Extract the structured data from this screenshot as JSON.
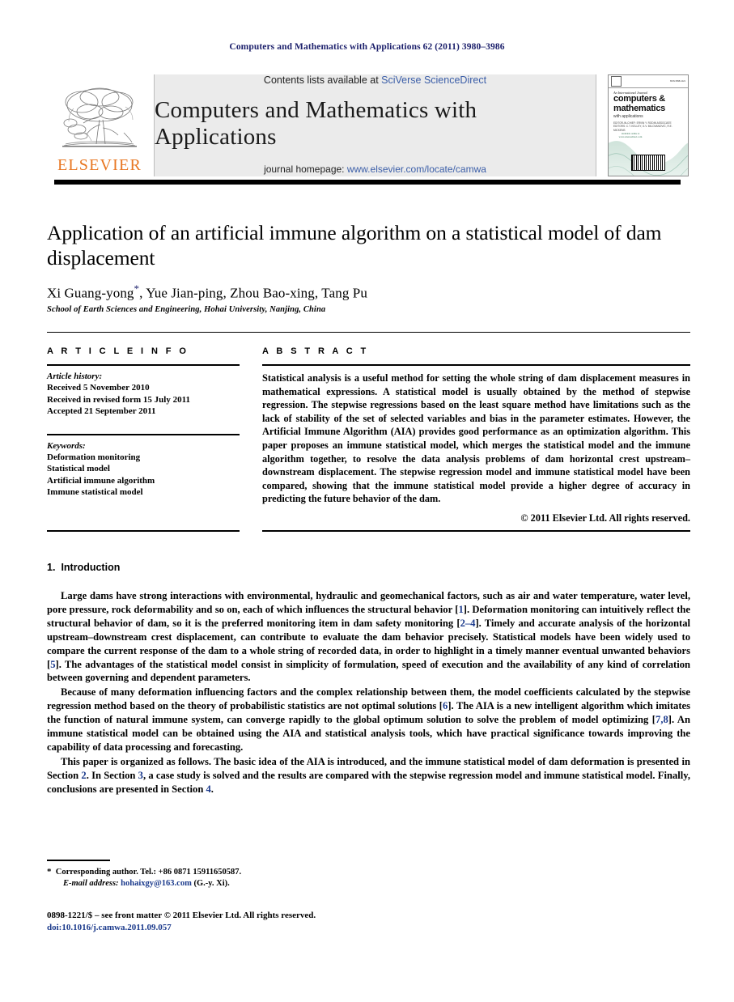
{
  "running_head": "Computers and Mathematics with Applications 62 (2011) 3980–3986",
  "masthead": {
    "publisher_name": "ELSEVIER",
    "contents_prefix": "Contents lists available at ",
    "contents_link": "SciVerse ScienceDirect",
    "journal_name": "Computers and Mathematics with Applications",
    "homepage_prefix": "journal homepage: ",
    "homepage_url": "www.elsevier.com/locate/camwa",
    "cover": {
      "line1": "An International Journal",
      "line2": "computers &",
      "line3": "mathematics",
      "line4": "with applications",
      "editors": "EDITOR-IN-CHIEF: ERVIN Y. RODIN\nASSOCIATE EDITORS: C.T. KELLEY, G.V. MILOVANOVIĆ, R.E. MICKENS",
      "top_left": "PERGAMON PRESS",
      "top_right": "ISSN 0898-1221",
      "seal": "Available online at www.sciencedirect.com"
    }
  },
  "title": "Application of an artificial immune algorithm on a statistical model of dam displacement",
  "authors": "Xi Guang-yong",
  "authors_rest": ", Yue Jian-ping, Zhou Bao-xing, Tang Pu",
  "corresponding_marker": "*",
  "affiliation": "School of Earth Sciences and Engineering, Hohai University, Nanjing, China",
  "article_info": {
    "label": "A R T I C L E    I N F O",
    "history_label": "Article history:",
    "history": [
      "Received 5 November 2010",
      "Received in revised form 15 July 2011",
      "Accepted 21 September 2011"
    ],
    "keywords_label": "Keywords:",
    "keywords": [
      "Deformation monitoring",
      "Statistical model",
      "Artificial immune algorithm",
      "Immune statistical model"
    ]
  },
  "abstract": {
    "label": "A B S T R A C T",
    "text": "Statistical analysis is a useful method for setting the whole string of dam displacement measures in mathematical expressions. A statistical model is usually obtained by the method of stepwise regression. The stepwise regressions based on the least square method have limitations such as the lack of stability of the set of selected variables and bias in the parameter estimates. However, the Artificial Immune Algorithm (AIA) provides good performance as an optimization algorithm. This paper proposes an immune statistical model, which merges the statistical model and the immune algorithm together, to resolve the data analysis problems of dam horizontal crest upstream–downstream displacement. The stepwise regression model and immune statistical model have been compared, showing that the immune statistical model provide a higher degree of accuracy in predicting the future behavior of the dam.",
    "copyright": "© 2011 Elsevier Ltd. All rights reserved."
  },
  "section": {
    "number": "1.",
    "heading": "Introduction",
    "paragraphs": [
      {
        "parts": [
          {
            "t": "Large dams have strong interactions with environmental, hydraulic and geomechanical factors, such as air and water temperature, water level, pore pressure, rock deformability and so on, each of which influences the structural behavior ["
          },
          {
            "t": "1",
            "ref": true
          },
          {
            "t": "]. Deformation monitoring can intuitively reflect the structural behavior of dam, so it is the preferred monitoring item in dam safety monitoring ["
          },
          {
            "t": "2–4",
            "ref": true
          },
          {
            "t": "]. Timely and accurate analysis of the horizontal upstream–downstream crest displacement, can contribute to evaluate the dam behavior precisely. Statistical models have been widely used to compare the current response of the dam to a whole string of recorded data, in order to highlight in a timely manner eventual unwanted behaviors ["
          },
          {
            "t": "5",
            "ref": true
          },
          {
            "t": "]. The advantages of the statistical model consist in simplicity of formulation, speed of execution and the availability of any kind of correlation between governing and dependent parameters."
          }
        ]
      },
      {
        "parts": [
          {
            "t": "Because of many deformation influencing factors and the complex relationship between them, the model coefficients calculated by the stepwise regression method based on the theory of probabilistic statistics are not optimal solutions ["
          },
          {
            "t": "6",
            "ref": true
          },
          {
            "t": "]. The AIA is a new intelligent algorithm which imitates the function of natural immune system, can converge rapidly to the global optimum solution to solve the problem of model optimizing ["
          },
          {
            "t": "7,8",
            "ref": true
          },
          {
            "t": "]. An immune statistical model can be obtained using the AIA and statistical analysis tools, which have practical significance towards improving the capability of data processing and forecasting."
          }
        ]
      },
      {
        "parts": [
          {
            "t": "This paper is organized as follows. The basic idea of the AIA is introduced, and the immune statistical model of dam deformation is presented in Section "
          },
          {
            "t": "2",
            "ref": true
          },
          {
            "t": ". In Section "
          },
          {
            "t": "3",
            "ref": true
          },
          {
            "t": ", a case study is solved and the results are compared with the stepwise regression model and immune statistical model. Finally, conclusions are presented in Section "
          },
          {
            "t": "4",
            "ref": true
          },
          {
            "t": "."
          }
        ]
      }
    ]
  },
  "footnotes": {
    "corresponding": "Corresponding author. Tel.: +86 0871 15911650587.",
    "email_label": "E-mail address:",
    "email": "hohaixgy@163.com",
    "email_suffix": "(G.-y. Xi)."
  },
  "imprint": {
    "line1": "0898-1221/$ – see front matter © 2011 Elsevier Ltd. All rights reserved.",
    "doi": "doi:10.1016/j.camwa.2011.09.057"
  },
  "colors": {
    "link": "#3b5ea8",
    "ref": "#1b3a8c",
    "running_head": "#1b1f6b",
    "elsevier_orange": "#E87722",
    "band_bg": "#ebebeb"
  }
}
